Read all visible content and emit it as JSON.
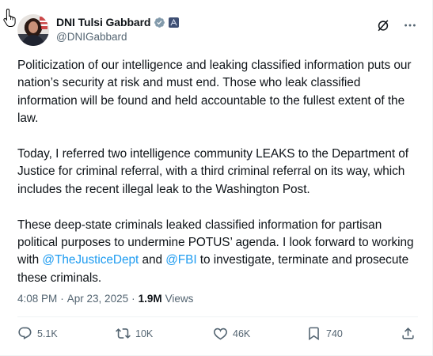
{
  "author": {
    "display_name": "DNI Tulsi Gabbard",
    "handle": "@DNIGabbard"
  },
  "post": {
    "paragraphs": [
      [
        {
          "text": "Politicization of our intelligence and leaking classified information puts our nation’s security at risk and must end. Those who leak classified information will be found and held accountable to the fullest extent of the law."
        }
      ],
      [
        {
          "text": "Today, I referred two intelligence community LEAKS to the Department of Justice for criminal referral, with a third criminal referral on its way, which includes the recent illegal leak to the Washington Post."
        }
      ],
      [
        {
          "text": "These deep-state criminals leaked classified information for partisan political purposes to undermine POTUS’ agenda.  I look forward to working with "
        },
        {
          "text": "@TheJusticeDept",
          "mention": true
        },
        {
          "text": " and "
        },
        {
          "text": "@FBI",
          "mention": true
        },
        {
          "text": " to investigate, terminate and prosecute these criminals."
        }
      ]
    ]
  },
  "meta": {
    "time": "4:08 PM",
    "separator": "·",
    "date": "Apr 23, 2025",
    "views_count": "1.9M",
    "views_label": "Views"
  },
  "actions": {
    "replies": "5.1K",
    "reposts": "10K",
    "likes": "46K",
    "bookmarks": "740"
  },
  "colors": {
    "text": "#0f1419",
    "muted": "#536471",
    "link": "#1d9bf0",
    "verified_badge": "#829aab",
    "gov_badge": "#3e4f73"
  },
  "icons": {
    "verified": "verified-badge-icon",
    "gov": "government-badge-icon",
    "grok": "grok-icon",
    "more": "more-icon",
    "reply": "reply-icon",
    "repost": "repost-icon",
    "like": "heart-icon",
    "bookmark": "bookmark-icon",
    "share": "share-icon"
  }
}
